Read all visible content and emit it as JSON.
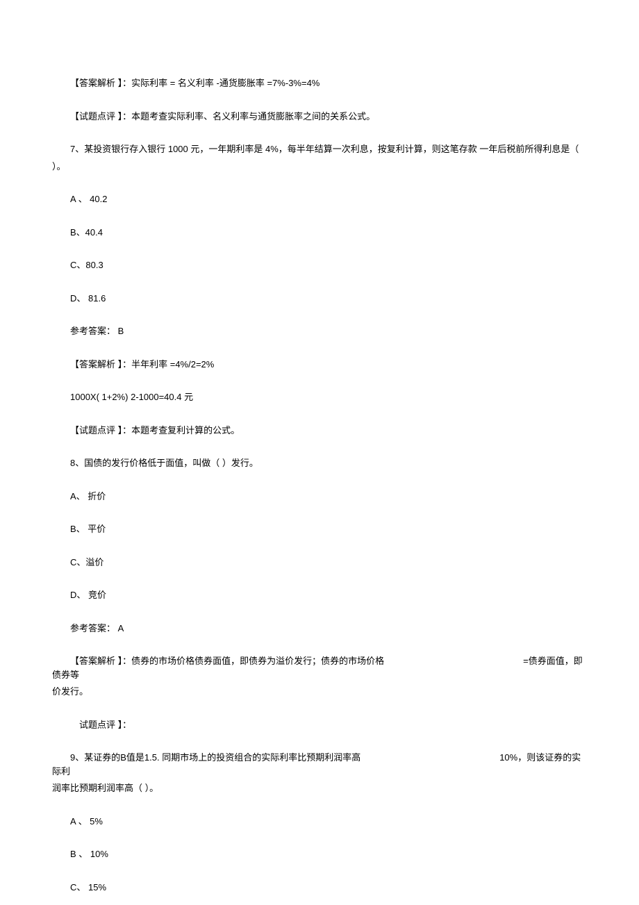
{
  "l1": "【答案解析 】：实际利率 = 名义利率 -通货膨胀率 =7%-3%=4%",
  "l2": "【试题点评 】：本题考查实际利率、名义利率与通货膨胀率之间的关系公式。",
  "q7": "7、某投资银行存入银行 1000 元，一年期利率是 4%，每半年结算一次利息，按复利计算，则这笔存款 一年后税前所得利息是（",
  "q7_end": "）。",
  "q7_a": "A 、 40.2",
  "q7_b": "B、40.4",
  "q7_c": "C、80.3",
  "q7_d": "D、  81.6",
  "q7_ans": "参考答案： B",
  "q7_exp1": "【答案解析 】：半年利率 =4%/2=2%",
  "q7_exp2": "1000X( 1+2%) 2-1000=40.4 元",
  "q7_rev": "【试题点评 】：本题考查复利计算的公式。",
  "q8": "8、国债的发行价格低于面值，叫做（             ）发行。",
  "q8_a": "A、 折价",
  "q8_b": "B、 平价",
  "q8_c": "C、溢价",
  "q8_d": "D、 竞价",
  "q8_ans": "参考答案： A",
  "q8_exp_a": "【答案解析 】：债券的市场价格债券面值，即债券为溢价发行；债券的市场价格",
  "q8_exp_b": "=债券面值，即债券等",
  "q8_exp_c": "价发行。",
  "q8_rev": "试题点评 】：",
  "q9_a1": "9、某证券的B值是1.5. 同期市场上的投资组合的实际利率比预期利润率高",
  "q9_a2": "10%，则该证券的实际利",
  "q9_b": "润率比预期利润率高（ ）。",
  "q9_opt_a": "A 、 5%",
  "q9_opt_b": "B 、 10%",
  "q9_opt_c": "C、 15%"
}
